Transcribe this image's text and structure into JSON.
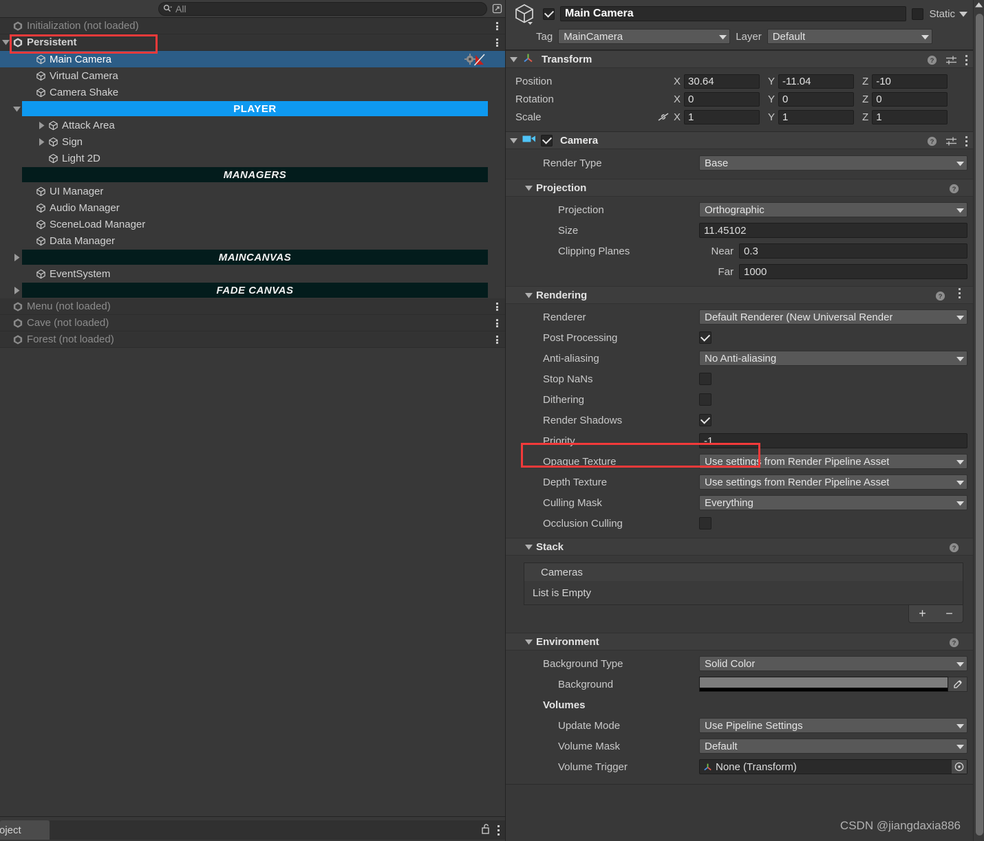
{
  "hierarchy": {
    "search": {
      "placeholder": "All",
      "icon": "search-icon"
    },
    "rows": [
      {
        "kind": "scene",
        "label": "Initialization (not loaded)",
        "dim": true,
        "kebab": true,
        "expanded": false,
        "arrow": false
      },
      {
        "kind": "scene",
        "label": "Persistent",
        "dim": false,
        "kebab": true,
        "expanded": true,
        "arrow": true
      },
      {
        "kind": "go",
        "label": "Main Camera",
        "indent": 1,
        "selected": true,
        "arrow": false,
        "badge": "cinemachine-brain-icon"
      },
      {
        "kind": "go",
        "label": "Virtual Camera",
        "indent": 1,
        "selected": false,
        "arrow": false
      },
      {
        "kind": "go",
        "label": "Camera Shake",
        "indent": 1,
        "selected": false,
        "arrow": false
      },
      {
        "kind": "banner",
        "label": "PLAYER",
        "style": "player",
        "indent": 0,
        "arrow": true,
        "expanded": true
      },
      {
        "kind": "go",
        "label": "Attack Area",
        "indent": 2,
        "selected": false,
        "arrow": true,
        "expanded": false
      },
      {
        "kind": "go",
        "label": "Sign",
        "indent": 2,
        "selected": false,
        "arrow": true,
        "expanded": false
      },
      {
        "kind": "go",
        "label": "Light 2D",
        "indent": 2,
        "selected": false,
        "arrow": false
      },
      {
        "kind": "banner",
        "label": "MANAGERS",
        "style": "dark",
        "indent": 0,
        "arrow": false
      },
      {
        "kind": "go",
        "label": "UI Manager",
        "indent": 1,
        "selected": false,
        "arrow": false
      },
      {
        "kind": "go",
        "label": "Audio Manager",
        "indent": 1,
        "selected": false,
        "arrow": false
      },
      {
        "kind": "go",
        "label": "SceneLoad Manager",
        "indent": 1,
        "selected": false,
        "arrow": false
      },
      {
        "kind": "go",
        "label": "Data Manager",
        "indent": 1,
        "selected": false,
        "arrow": false
      },
      {
        "kind": "banner",
        "label": "MAINCANVAS",
        "style": "dark",
        "indent": 0,
        "arrow": true,
        "expanded": false
      },
      {
        "kind": "go",
        "label": "EventSystem",
        "indent": 1,
        "selected": false,
        "arrow": false
      },
      {
        "kind": "banner",
        "label": "FADE CANVAS",
        "style": "dark",
        "indent": 0,
        "arrow": true,
        "expanded": false
      },
      {
        "kind": "scene",
        "label": "Menu (not loaded)",
        "dim": true,
        "kebab": true,
        "arrow": false
      },
      {
        "kind": "scene",
        "label": "Cave (not loaded)",
        "dim": true,
        "kebab": true,
        "arrow": false
      },
      {
        "kind": "scene",
        "label": "Forest (not loaded)",
        "dim": true,
        "kebab": true,
        "arrow": false
      }
    ],
    "footer": {
      "tab_label": "roject",
      "lock_icon": "lock-open-icon",
      "menu_icon": "kebab-menu-icon"
    }
  },
  "inspector": {
    "object": {
      "enabled": true,
      "name": "Main Camera",
      "static_label": "Static",
      "static_checked": false,
      "tag_label": "Tag",
      "tag_value": "MainCamera",
      "layer_label": "Layer",
      "layer_value": "Default"
    },
    "transform": {
      "title": "Transform",
      "expanded": true,
      "position_label": "Position",
      "position": {
        "x": "30.64",
        "y": "-11.04",
        "z": "-10"
      },
      "rotation_label": "Rotation",
      "rotation": {
        "x": "0",
        "y": "0",
        "z": "0"
      },
      "scale_label": "Scale",
      "scale": {
        "x": "1",
        "y": "1",
        "z": "1"
      },
      "axis_labels": {
        "x": "X",
        "y": "Y",
        "z": "Z"
      }
    },
    "camera": {
      "title": "Camera",
      "enabled": true,
      "render_type_label": "Render Type",
      "render_type_value": "Base",
      "projection": {
        "title": "Projection",
        "projection_label": "Projection",
        "projection_value": "Orthographic",
        "size_label": "Size",
        "size_value": "11.45102",
        "clipping_label": "Clipping Planes",
        "near_label": "Near",
        "near_value": "0.3",
        "far_label": "Far",
        "far_value": "1000"
      },
      "rendering": {
        "title": "Rendering",
        "renderer_label": "Renderer",
        "renderer_value": "Default Renderer (New Universal Render",
        "post_processing_label": "Post Processing",
        "post_processing_checked": true,
        "anti_aliasing_label": "Anti-aliasing",
        "anti_aliasing_value": "No Anti-aliasing",
        "stop_nans_label": "Stop NaNs",
        "stop_nans_checked": false,
        "dithering_label": "Dithering",
        "dithering_checked": false,
        "render_shadows_label": "Render Shadows",
        "render_shadows_checked": true,
        "priority_label": "Priority",
        "priority_value": "-1",
        "opaque_texture_label": "Opaque Texture",
        "opaque_texture_value": "Use settings from Render Pipeline Asset",
        "depth_texture_label": "Depth Texture",
        "depth_texture_value": "Use settings from Render Pipeline Asset",
        "culling_mask_label": "Culling Mask",
        "culling_mask_value": "Everything",
        "occlusion_culling_label": "Occlusion Culling",
        "occlusion_culling_checked": false
      },
      "stack": {
        "title": "Stack",
        "list_header": "Cameras",
        "empty_text": "List is Empty",
        "add_label": "+",
        "remove_label": "−"
      },
      "environment": {
        "title": "Environment",
        "background_type_label": "Background Type",
        "background_type_value": "Solid Color",
        "background_label": "Background",
        "background_color": "#7c7c7c",
        "volumes_label": "Volumes",
        "update_mode_label": "Update Mode",
        "update_mode_value": "Use Pipeline Settings",
        "volume_mask_label": "Volume Mask",
        "volume_mask_value": "Default",
        "volume_trigger_label": "Volume Trigger",
        "volume_trigger_value": "None (Transform)"
      }
    }
  },
  "annotations": {
    "highlight_color": "#f33a3a",
    "watermark": "CSDN @jiangdaxia886"
  }
}
